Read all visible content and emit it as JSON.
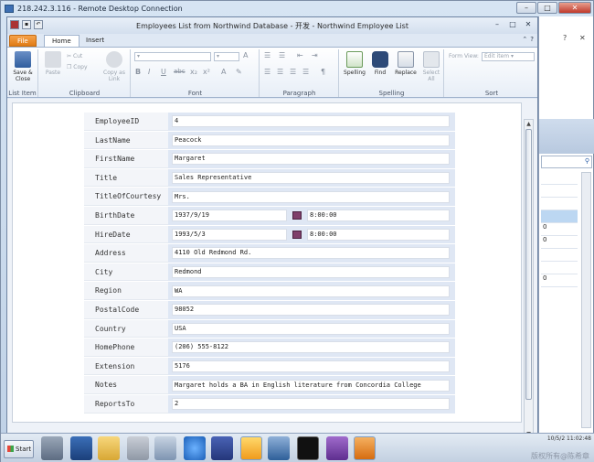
{
  "rdp": {
    "title": "218.242.3.116 - Remote Desktop Connection",
    "min": "–",
    "max": "□",
    "close": "✕"
  },
  "window": {
    "title": "Employees List from Northwind Database - 开发 - Northwind Employee List",
    "min": "–",
    "max": "□",
    "close": "✕"
  },
  "tabs": {
    "file": "File",
    "home": "Home",
    "insert": "Insert"
  },
  "ribbon": {
    "list_item": {
      "save_close": "Save & Close",
      "group": "List Item"
    },
    "clipboard": {
      "paste": "Paste",
      "cut": "Cut",
      "copy": "Copy",
      "copy_as_link": "Copy as Link",
      "group": "Clipboard"
    },
    "font": {
      "bold": "B",
      "italic": "I",
      "underline": "U",
      "strike": "abc",
      "sub": "x₂",
      "sup": "x²",
      "group": "Font"
    },
    "paragraph": {
      "group": "Paragraph"
    },
    "spelling": {
      "spelling": "Spelling",
      "find": "Find",
      "replace": "Replace",
      "select_all": "Select All",
      "group": "Spelling"
    },
    "sort": {
      "form_view_label": "Form View:",
      "form_view_value": "Edit item",
      "group": "Sort"
    }
  },
  "form": {
    "fields": [
      {
        "label": "EmployeeID",
        "value": "4"
      },
      {
        "label": "LastName",
        "value": "Peacock"
      },
      {
        "label": "FirstName",
        "value": "Margaret"
      },
      {
        "label": "Title",
        "value": "Sales Representative"
      },
      {
        "label": "TitleOfCourtesy",
        "value": "Mrs."
      },
      {
        "label": "BirthDate",
        "date": "1937/9/19",
        "time": "8:00:00"
      },
      {
        "label": "HireDate",
        "date": "1993/5/3",
        "time": "8:00:00"
      },
      {
        "label": "Address",
        "value": "4110 Old Redmond Rd."
      },
      {
        "label": "City",
        "value": "Redmond"
      },
      {
        "label": "Region",
        "value": "WA"
      },
      {
        "label": "PostalCode",
        "value": "98052"
      },
      {
        "label": "Country",
        "value": "USA"
      },
      {
        "label": "HomePhone",
        "value": "(206) 555-8122"
      },
      {
        "label": "Extension",
        "value": "5176"
      },
      {
        "label": "Notes",
        "value": "Margaret holds a BA in English literature from Concordia College"
      },
      {
        "label": "ReportsTo",
        "value": "2"
      }
    ]
  },
  "background_app": {
    "list_values": [
      "0",
      "0",
      "0"
    ]
  },
  "taskbar": {
    "start": "Start",
    "datetime": "10/5/2 11:02:48",
    "watermark": "版权所有@陈希章"
  }
}
